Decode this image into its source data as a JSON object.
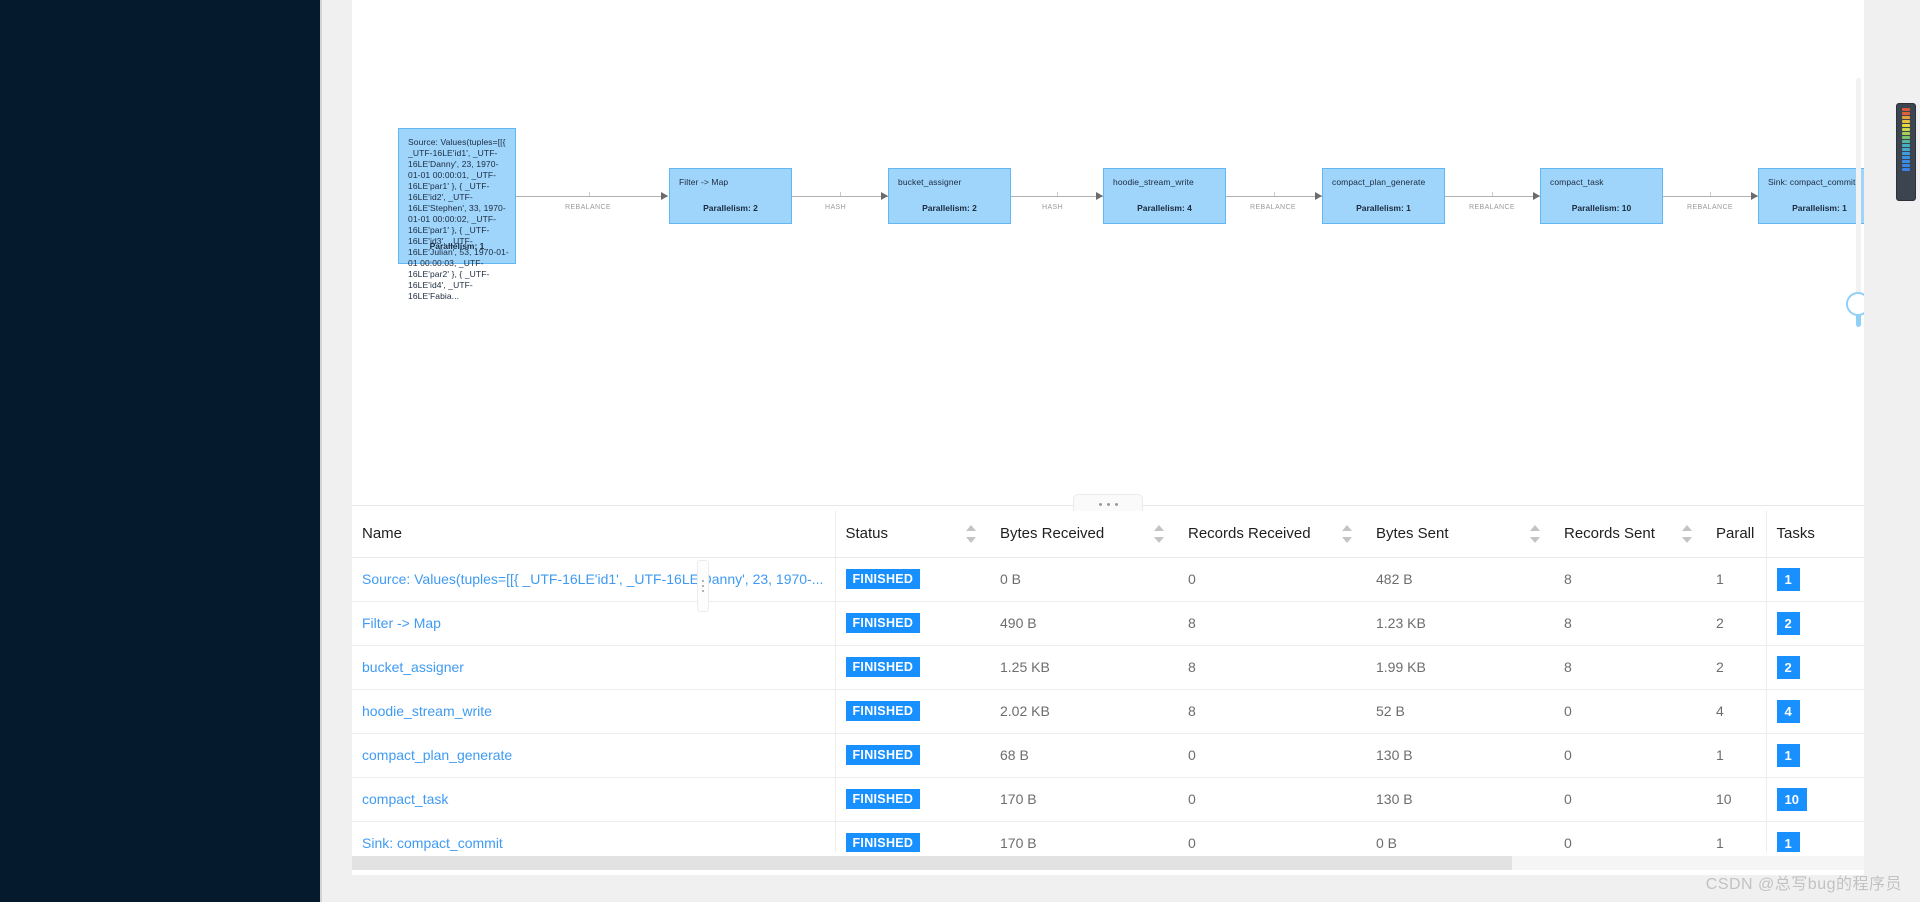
{
  "graph": {
    "nodes": [
      {
        "id": "source",
        "label": "Source: Values(tuples=[[{ _UTF-16LE'id1', _UTF-16LE'Danny', 23, 1970-01-01 00:00:01, _UTF-16LE'par1' }, { _UTF-16LE'id2', _UTF-16LE'Stephen', 33, 1970-01-01 00:00:02, _UTF-16LE'par1' }, { _UTF-16LE'id3', _UTF-16LE'Julian', 53, 1970-01-01 00:00:03, _UTF-16LE'par2' }, { _UTF-16LE'id4', _UTF-16LE'Fabia...",
        "parallelism": "Parallelism: 1"
      },
      {
        "id": "filter-map",
        "label": "Filter -> Map",
        "parallelism": "Parallelism: 2"
      },
      {
        "id": "bucket-assigner",
        "label": "bucket_assigner",
        "parallelism": "Parallelism: 2"
      },
      {
        "id": "hoodie-stream-write",
        "label": "hoodie_stream_write",
        "parallelism": "Parallelism: 4"
      },
      {
        "id": "compact-plan-generate",
        "label": "compact_plan_generate",
        "parallelism": "Parallelism: 1"
      },
      {
        "id": "compact-task",
        "label": "compact_task",
        "parallelism": "Parallelism: 10"
      },
      {
        "id": "sink-compact-commit",
        "label": "Sink: compact_commit",
        "parallelism": "Parallelism: 1"
      }
    ],
    "edges": [
      {
        "label": "REBALANCE"
      },
      {
        "label": "HASH"
      },
      {
        "label": "HASH"
      },
      {
        "label": "REBALANCE"
      },
      {
        "label": "REBALANCE"
      },
      {
        "label": "REBALANCE"
      }
    ],
    "zoom_slider": {
      "name": "graph-zoom-slider"
    }
  },
  "splitter": {
    "dots": "..."
  },
  "table": {
    "columns": [
      {
        "key": "name",
        "label": "Name",
        "sortable": false
      },
      {
        "key": "status",
        "label": "Status",
        "sortable": true
      },
      {
        "key": "brecv",
        "label": "Bytes Received",
        "sortable": true
      },
      {
        "key": "rrecv",
        "label": "Records Received",
        "sortable": true
      },
      {
        "key": "bsent",
        "label": "Bytes Sent",
        "sortable": true
      },
      {
        "key": "rsent",
        "label": "Records Sent",
        "sortable": true
      },
      {
        "key": "par",
        "label": "Parall",
        "sortable": false
      },
      {
        "key": "tasks",
        "label": "Tasks",
        "sortable": false
      }
    ],
    "rows": [
      {
        "name": "Source: Values(tuples=[[{ _UTF-16LE'id1', _UTF-16LE'Danny', 23, 1970-...",
        "status": "FINISHED",
        "brecv": "0 B",
        "rrecv": "0",
        "bsent": "482 B",
        "rsent": "8",
        "par": "1",
        "tasks": "1"
      },
      {
        "name": "Filter -> Map",
        "status": "FINISHED",
        "brecv": "490 B",
        "rrecv": "8",
        "bsent": "1.23 KB",
        "rsent": "8",
        "par": "2",
        "tasks": "2"
      },
      {
        "name": "bucket_assigner",
        "status": "FINISHED",
        "brecv": "1.25 KB",
        "rrecv": "8",
        "bsent": "1.99 KB",
        "rsent": "8",
        "par": "2",
        "tasks": "2"
      },
      {
        "name": "hoodie_stream_write",
        "status": "FINISHED",
        "brecv": "2.02 KB",
        "rrecv": "8",
        "bsent": "52 B",
        "rsent": "0",
        "par": "4",
        "tasks": "4"
      },
      {
        "name": "compact_plan_generate",
        "status": "FINISHED",
        "brecv": "68 B",
        "rrecv": "0",
        "bsent": "130 B",
        "rsent": "0",
        "par": "1",
        "tasks": "1"
      },
      {
        "name": "compact_task",
        "status": "FINISHED",
        "brecv": "170 B",
        "rrecv": "0",
        "bsent": "130 B",
        "rsent": "0",
        "par": "10",
        "tasks": "10"
      },
      {
        "name": "Sink: compact_commit",
        "status": "FINISHED",
        "brecv": "170 B",
        "rrecv": "0",
        "bsent": "0 B",
        "rsent": "0",
        "par": "1",
        "tasks": "1"
      }
    ]
  },
  "watermark": "CSDN @总写bug的程序员",
  "colors": {
    "node_fill": "#9fd4fb",
    "node_border": "#60b7f5",
    "badge": "#1890ff",
    "link": "#3f9bf2",
    "rail": "#061a2e"
  }
}
